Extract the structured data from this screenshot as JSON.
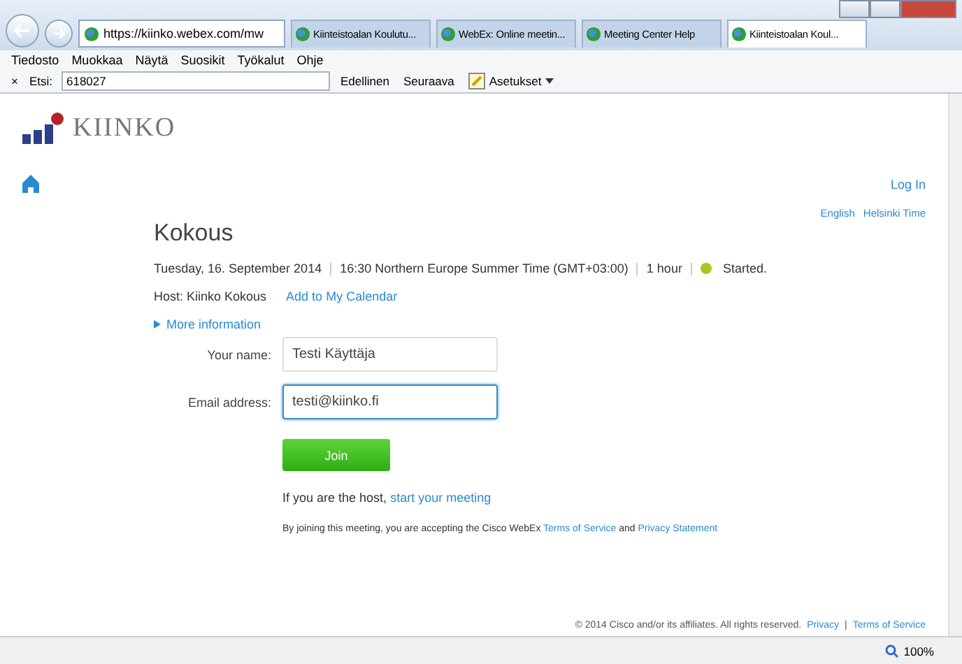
{
  "browser": {
    "address": "https://kiinko.webex.com/mw",
    "tabs": [
      {
        "label": "Kiinteistoalan Koulutu...",
        "selected": false
      },
      {
        "label": "WebEx: Online meetin...",
        "selected": false
      },
      {
        "label": "Meeting Center Help",
        "selected": false
      },
      {
        "label": "Kiinteistoalan Koul...",
        "selected": true
      }
    ],
    "menu": [
      "Tiedosto",
      "Muokkaa",
      "Näytä",
      "Suosikit",
      "Työkalut",
      "Ohje"
    ],
    "find_bar": {
      "close": "×",
      "label": "Etsi:",
      "value": "618027",
      "previous": "Edellinen",
      "next": "Seuraava",
      "options": "Asetukset"
    }
  },
  "page": {
    "logo_text": "KIINKO",
    "login": "Log In",
    "language": "English",
    "timezone": "Helsinki Time",
    "title": "Kokous",
    "meta": [
      {
        "kind": "text",
        "text": "Tuesday, 16. September 2014"
      },
      {
        "kind": "text",
        "text": "16:30 Northern Europe Summer Time (GMT+03:00)"
      },
      {
        "kind": "text",
        "text": "1 hour"
      },
      {
        "kind": "status",
        "text": "Started.",
        "color": "#a6c81e"
      }
    ],
    "host": "Host: Kiinko Kokous",
    "calendar_link": "Add to My Calendar",
    "more_info": {
      "label": "More information",
      "expanded": false
    },
    "fields": [
      {
        "label": "Your name:",
        "value": "Testi Käyttäja",
        "focused": false
      },
      {
        "label": "Email address:",
        "value": "testi@kiinko.fi",
        "focused": true
      }
    ],
    "join_button": "Join",
    "host_line": {
      "text": "If you are the host,",
      "link": "start your meeting"
    },
    "terms": {
      "text": "By joining this meeting, you are accepting the Cisco WebEx",
      "link1": "Terms of Service",
      "joiner": "and",
      "link2": "Privacy Statement"
    },
    "footer": {
      "copyright": "© 2014 Cisco and/or its affiliates. All rights reserved.",
      "privacy": "Privacy",
      "separator": "|",
      "terms": "Terms of Service"
    }
  },
  "status_bar": {
    "zoom": "100%"
  }
}
